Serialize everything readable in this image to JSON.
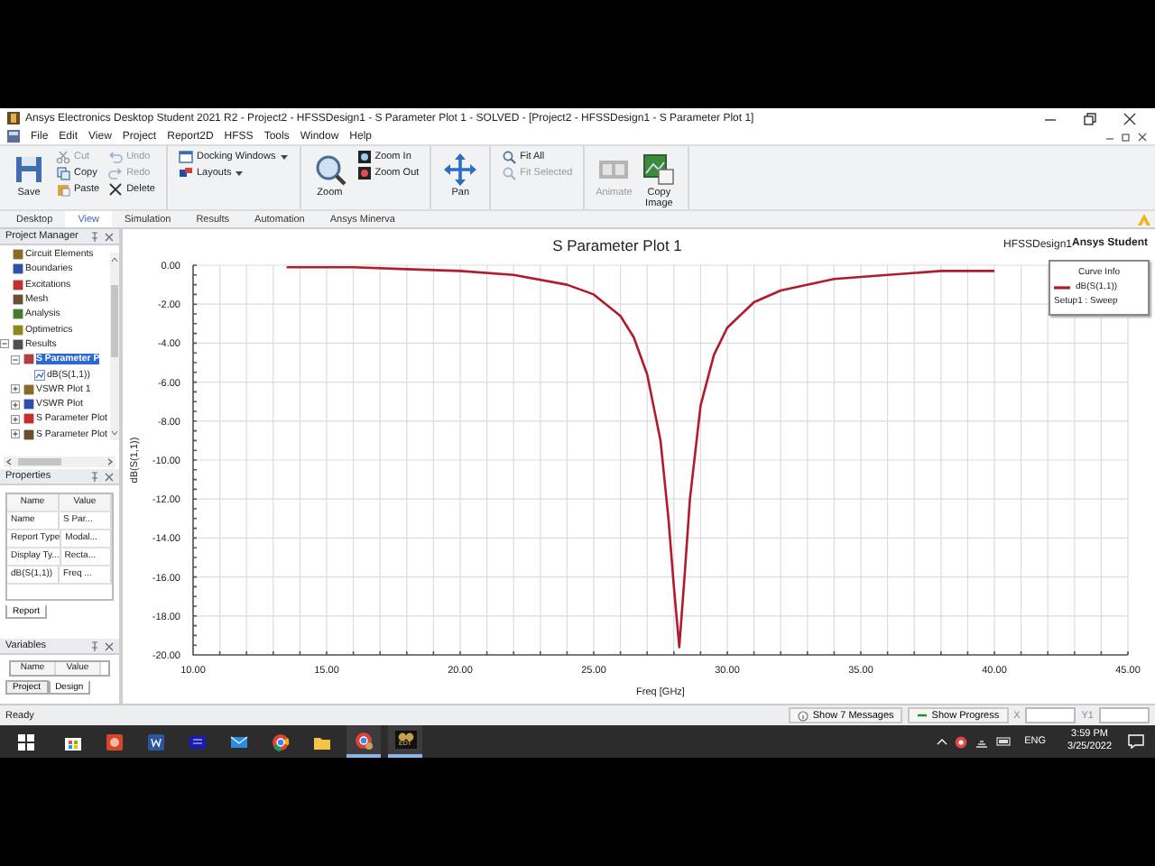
{
  "window": {
    "title": "Ansys Electronics Desktop Student 2021 R2 - Project2 - HFSSDesign1 - S Parameter Plot 1 - SOLVED - [Project2 - HFSSDesign1 - S Parameter Plot 1]"
  },
  "menu": [
    "File",
    "Edit",
    "View",
    "Project",
    "Report2D",
    "HFSS",
    "Tools",
    "Window",
    "Help"
  ],
  "ribbon": {
    "groups": [
      {
        "columns": [
          [
            {
              "label": "Save",
              "kind": "large",
              "disabled": false
            }
          ],
          [
            {
              "label": "Cut",
              "kind": "small",
              "disabled": true
            },
            {
              "label": "Copy",
              "kind": "small",
              "disabled": false
            },
            {
              "label": "Paste",
              "kind": "small",
              "disabled": false
            }
          ],
          [
            {
              "label": "Undo",
              "kind": "small",
              "disabled": true
            },
            {
              "label": "Redo",
              "kind": "small",
              "disabled": true
            },
            {
              "label": "Delete",
              "kind": "small",
              "disabled": false
            }
          ]
        ]
      },
      {
        "columns": [
          [
            {
              "label": "Docking Windows",
              "kind": "small",
              "disabled": false,
              "dropdown": true
            },
            {
              "label": "Layouts",
              "kind": "small",
              "disabled": false,
              "dropdown": true
            }
          ]
        ]
      },
      {
        "columns": [
          [
            {
              "label": "Zoom",
              "kind": "large",
              "disabled": false
            }
          ],
          [
            {
              "label": "Zoom In",
              "kind": "small",
              "disabled": false
            },
            {
              "label": "Zoom Out",
              "kind": "small",
              "disabled": false
            }
          ]
        ]
      },
      {
        "columns": [
          [
            {
              "label": "Pan",
              "kind": "large",
              "disabled": false
            }
          ]
        ]
      },
      {
        "columns": [
          [
            {
              "label": "Fit All",
              "kind": "small",
              "disabled": false
            },
            {
              "label": "Fit Selected",
              "kind": "small",
              "disabled": true
            }
          ]
        ]
      },
      {
        "columns": [
          [
            {
              "label": "Animate",
              "kind": "large",
              "disabled": true
            }
          ],
          [
            {
              "label": "Copy Image",
              "kind": "large",
              "disabled": false
            }
          ]
        ]
      }
    ]
  },
  "ribbon_tabs": [
    {
      "label": "Desktop",
      "selected": false
    },
    {
      "label": "View",
      "selected": true
    },
    {
      "label": "Simulation",
      "selected": false
    },
    {
      "label": "Results",
      "selected": false
    },
    {
      "label": "Automation",
      "selected": false
    },
    {
      "label": "Ansys Minerva",
      "selected": false
    }
  ],
  "project_manager": {
    "title": "Project Manager",
    "items": [
      {
        "label": "Circuit Elements",
        "selected": false
      },
      {
        "label": "Boundaries",
        "selected": false
      },
      {
        "label": "Excitations",
        "selected": false
      },
      {
        "label": "Mesh",
        "selected": false
      },
      {
        "label": "Analysis",
        "selected": false
      },
      {
        "label": "Optimetrics",
        "selected": false
      },
      {
        "label": "Results",
        "selected": false,
        "expanded": true,
        "children": [
          {
            "label": "S Parameter P",
            "selected": true,
            "expanded": true,
            "children": [
              {
                "label": "dB(S(1,1))",
                "selected": false
              }
            ]
          },
          {
            "label": "VSWR Plot 1",
            "selected": false,
            "expanded": false
          },
          {
            "label": "VSWR Plot",
            "selected": false,
            "expanded": false
          },
          {
            "label": "S Parameter Plot",
            "selected": false,
            "expanded": false
          },
          {
            "label": "S Parameter Plot",
            "selected": false,
            "expanded": false
          }
        ]
      }
    ]
  },
  "properties": {
    "title": "Properties",
    "columns": [
      "Name",
      "Value"
    ],
    "rows": [
      [
        "Name",
        "S Par..."
      ],
      [
        "Report Type",
        "Modal..."
      ],
      [
        "Display Ty...",
        "Recta..."
      ],
      [
        "dB(S(1,1))",
        "Freq ..."
      ]
    ],
    "tabs": [
      {
        "label": "Report",
        "selected": true
      }
    ]
  },
  "variables": {
    "title": "Variables",
    "columns": [
      "Name",
      "Value"
    ],
    "tabs": [
      {
        "label": "Project",
        "selected": false
      },
      {
        "label": "Design",
        "selected": true
      }
    ]
  },
  "plot": {
    "design": "HFSSDesign1",
    "brand": "Ansys Student",
    "legend": {
      "title": "Curve Info",
      "setup": "Setup1 : Sweep"
    },
    "chart_data": {
      "type": "line",
      "grid": true,
      "title": "S Parameter Plot 1",
      "xlabel": "Freq [GHz]",
      "ylabel": "dB(S(1,1))",
      "xlim": [
        10,
        45
      ],
      "ylim": [
        -20,
        0
      ],
      "xticks": [
        {
          "value": 10,
          "label": "10.00"
        },
        {
          "value": 15,
          "label": "15.00"
        },
        {
          "value": 20,
          "label": "20.00"
        },
        {
          "value": 25,
          "label": "25.00"
        },
        {
          "value": 30,
          "label": "30.00"
        },
        {
          "value": 35,
          "label": "35.00"
        },
        {
          "value": 40,
          "label": "40.00"
        },
        {
          "value": 45,
          "label": "45.00"
        }
      ],
      "yticks": [
        {
          "value": 0,
          "label": "0.00"
        },
        {
          "value": -2,
          "label": "-2.00"
        },
        {
          "value": -4,
          "label": "-4.00"
        },
        {
          "value": -6,
          "label": "-6.00"
        },
        {
          "value": -8,
          "label": "-8.00"
        },
        {
          "value": -10,
          "label": "-10.00"
        },
        {
          "value": -12,
          "label": "-12.00"
        },
        {
          "value": -14,
          "label": "-14.00"
        },
        {
          "value": -16,
          "label": "-16.00"
        },
        {
          "value": -18,
          "label": "-18.00"
        },
        {
          "value": -20,
          "label": "-20.00"
        }
      ],
      "x": [
        13.5,
        16,
        18,
        20,
        22,
        24,
        25,
        26,
        26.5,
        27,
        27.5,
        27.8,
        28,
        28.2,
        28.4,
        28.6,
        29,
        29.5,
        30,
        31,
        32,
        34,
        36,
        38,
        40
      ],
      "series": [
        {
          "name": "dB(S(1,1))",
          "color": "#b01c2e",
          "values": [
            -0.1,
            -0.1,
            -0.2,
            -0.3,
            -0.5,
            -1.0,
            -1.5,
            -2.6,
            -3.7,
            -5.6,
            -9.0,
            -13.0,
            -16.5,
            -19.6,
            -16.0,
            -12.0,
            -7.2,
            -4.6,
            -3.2,
            -1.9,
            -1.3,
            -0.7,
            -0.5,
            -0.3,
            -0.3
          ]
        }
      ]
    }
  },
  "status_bar": {
    "text": "Ready",
    "buttons": [
      "Show 7 Messages",
      "Show Progress"
    ],
    "fields": [
      {
        "label": "X"
      },
      {
        "label": "Y1"
      }
    ]
  },
  "taskbar": {
    "apps": [
      {
        "running": false
      },
      {
        "running": false
      },
      {
        "running": false
      },
      {
        "running": false
      },
      {
        "running": false
      },
      {
        "running": false
      },
      {
        "running": false
      },
      {
        "running": true
      },
      {
        "running": true,
        "label": "EDT"
      }
    ],
    "language": "ENG",
    "time": "3:59 PM",
    "date": "3/25/2022"
  }
}
